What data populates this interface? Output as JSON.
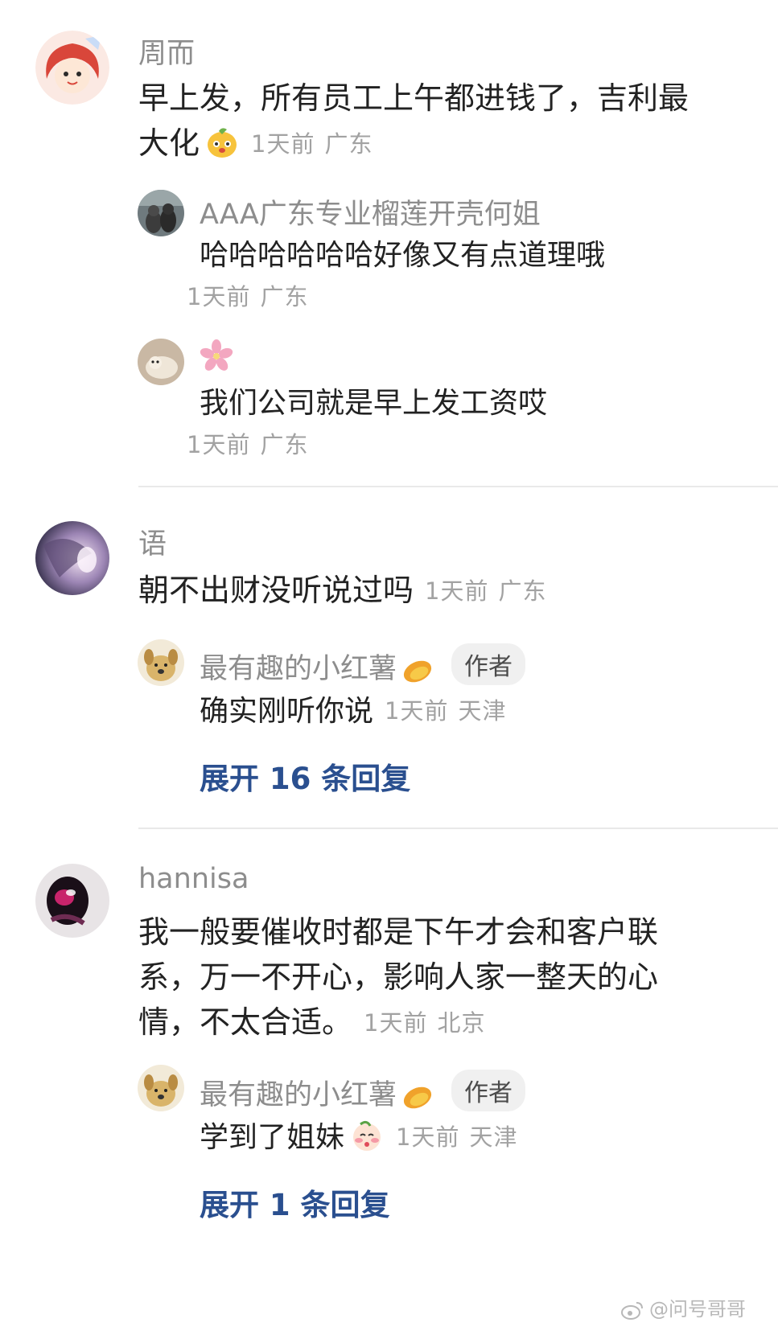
{
  "threads": [
    {
      "user": "周而",
      "text": "早上发，所有员工上午都进钱了，吉利最大化",
      "emoji": "peach-face-emoji",
      "time": "1天前",
      "location": "广东",
      "replies": [
        {
          "user": "AAA广东专业榴莲开壳何姐",
          "text": "哈哈哈哈哈哈好像又有点道理哦",
          "time": "1天前",
          "location": "广东"
        },
        {
          "user_icon": "cherry-blossom-icon",
          "text": "我们公司就是早上发工资哎",
          "time": "1天前",
          "location": "广东"
        }
      ]
    },
    {
      "user": "语",
      "text": "朝不出财没听说过吗",
      "time": "1天前",
      "location": "广东",
      "replies": [
        {
          "user": "最有趣的小红薯",
          "badge": "作者",
          "text": "确实刚听你说",
          "time": "1天前",
          "location": "天津"
        }
      ],
      "expand_label": "展开 16 条回复"
    },
    {
      "user": "hannisa",
      "text": "我一般要催收时都是下午才会和客户联系，万一不开心，影响人家一整天的心情，不太合适。",
      "time": "1天前",
      "location": "北京",
      "replies": [
        {
          "user": "最有趣的小红薯",
          "badge": "作者",
          "text": "学到了姐妹",
          "emoji": "blushing-face-emoji",
          "time": "1天前",
          "location": "天津"
        }
      ],
      "expand_label": "展开 1 条回复"
    }
  ],
  "watermark": "@问号哥哥",
  "colors": {
    "username": "#8d8d8d",
    "body": "#222222",
    "meta": "#a2a2a2",
    "expand_link": "#2a4f8f",
    "badge_bg": "#f0f0f0",
    "divider": "#e9e9e9"
  }
}
